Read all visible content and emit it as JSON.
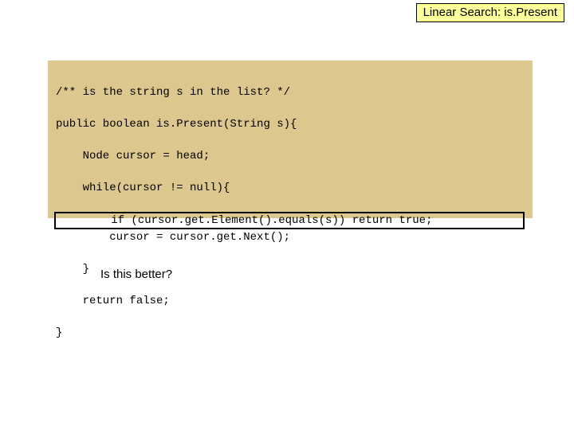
{
  "title": "Linear Search: is.Present",
  "code": {
    "l1": "/** is the string s in the list? */",
    "l2": "public boolean is.Present(String s){",
    "l3": "    Node cursor = head;",
    "l4": "    while(cursor != null){",
    "l5": "        if (cursor.get.Element().equals(s)) return true;",
    "l6": "        cursor = cursor.get.Next();",
    "l7": "    }",
    "l8": "    return false;",
    "l9": "}"
  },
  "question": "Is this better?"
}
